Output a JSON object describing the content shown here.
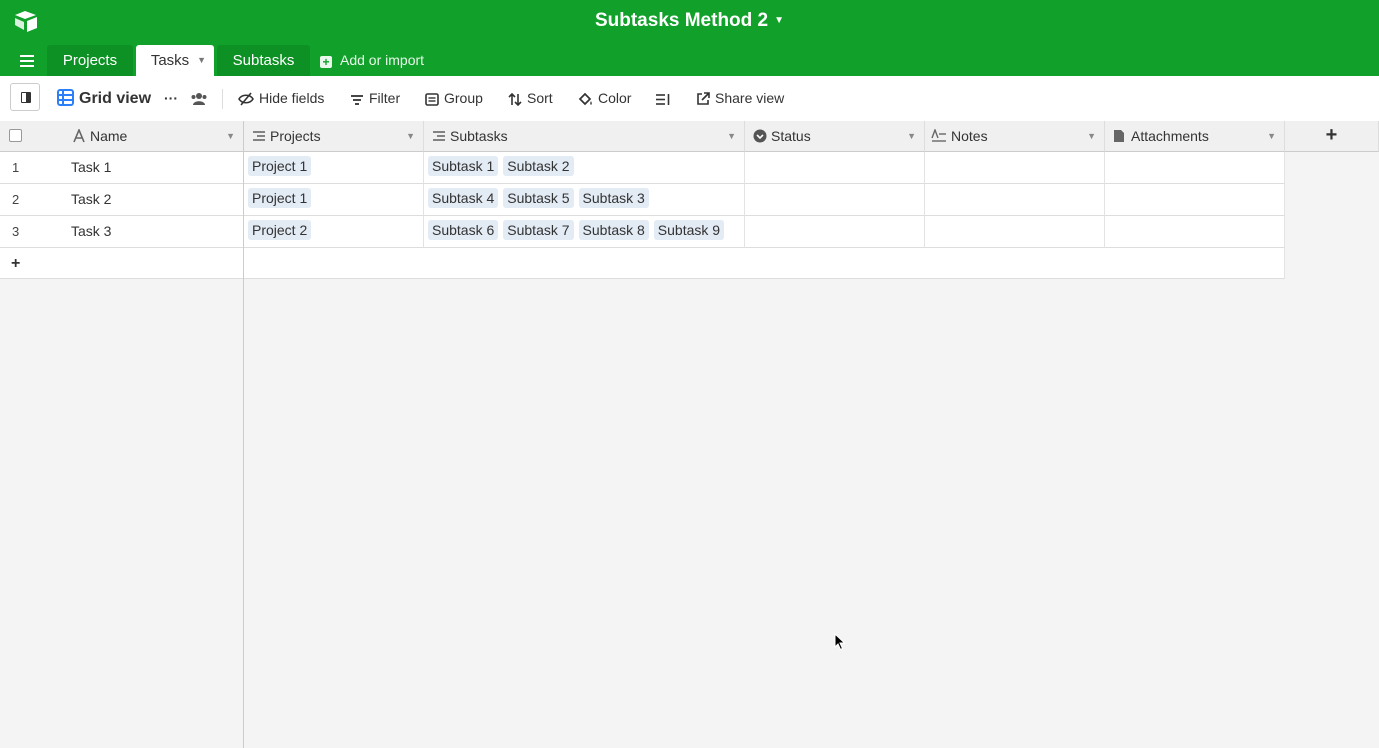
{
  "base": {
    "title": "Subtasks Method 2"
  },
  "tabs": [
    {
      "label": "Projects",
      "active": false
    },
    {
      "label": "Tasks",
      "active": true
    },
    {
      "label": "Subtasks",
      "active": false
    }
  ],
  "add_import_label": "Add or import",
  "toolbar": {
    "view_name": "Grid view",
    "hide_fields": "Hide fields",
    "filter": "Filter",
    "group": "Group",
    "sort": "Sort",
    "color": "Color",
    "share_view": "Share view"
  },
  "columns": [
    "Name",
    "Projects",
    "Subtasks",
    "Status",
    "Notes",
    "Attachments"
  ],
  "rows": [
    {
      "num": "1",
      "name": "Task 1",
      "projects": [
        "Project 1"
      ],
      "subtasks": [
        "Subtask 1",
        "Subtask 2"
      ]
    },
    {
      "num": "2",
      "name": "Task 2",
      "projects": [
        "Project 1"
      ],
      "subtasks": [
        "Subtask 4",
        "Subtask 5",
        "Subtask 3"
      ]
    },
    {
      "num": "3",
      "name": "Task 3",
      "projects": [
        "Project 2"
      ],
      "subtasks": [
        "Subtask 6",
        "Subtask 7",
        "Subtask 8",
        "Subtask 9"
      ]
    }
  ],
  "add_row_label": "+",
  "add_field_label": "+",
  "colors": {
    "topbar": "#11a12a",
    "chip": "#e3ebf5",
    "grid_icon": "#2d7ff9"
  }
}
